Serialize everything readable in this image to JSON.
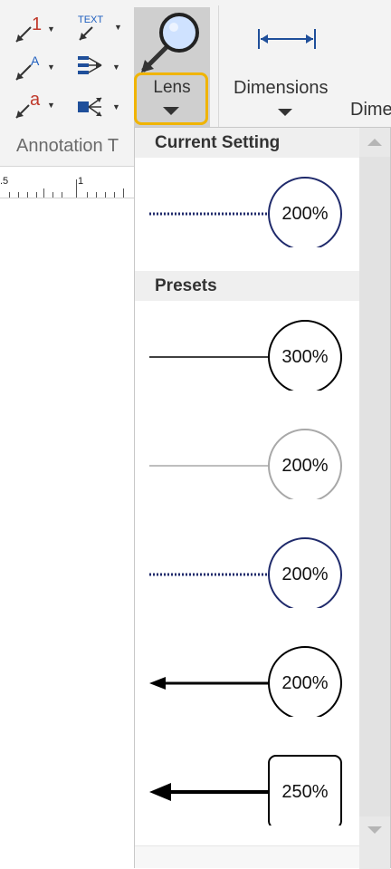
{
  "ribbon": {
    "annotation_group_label": "Annotation T",
    "lens_label": "Lens",
    "dimensions_label": "Dimensions",
    "dimensions_partial_label": "Dime",
    "text_tool_label": "TEXT",
    "number_tool_label": "1",
    "letter_a_tool_label": "A",
    "letter_a2_tool_label": "a"
  },
  "ruler": {
    "labels": [
      ".5",
      "1"
    ]
  },
  "dropdown": {
    "current_setting_header": "Current Setting",
    "presets_header": "Presets",
    "current_setting": {
      "value": "200%",
      "shape": "circle",
      "line_style": "dotted",
      "color": "#1f2a6b"
    },
    "presets": [
      {
        "value": "300%",
        "shape": "circle",
        "line_style": "solid-thin",
        "color": "#000000"
      },
      {
        "value": "200%",
        "shape": "circle",
        "line_style": "solid-thin",
        "color": "#a8a8a8"
      },
      {
        "value": "200%",
        "shape": "circle",
        "line_style": "dotted",
        "color": "#1f2a6b"
      },
      {
        "value": "200%",
        "shape": "circle",
        "line_style": "arrow-medium",
        "color": "#000000"
      },
      {
        "value": "250%",
        "shape": "rounded-rect",
        "line_style": "arrow-thick",
        "color": "#000000"
      }
    ]
  },
  "colors": {
    "highlight": "#f0b400",
    "ribbon_bg": "#f3f3f3",
    "accent_blue": "#1f5fbf",
    "accent_red": "#c0392b"
  }
}
